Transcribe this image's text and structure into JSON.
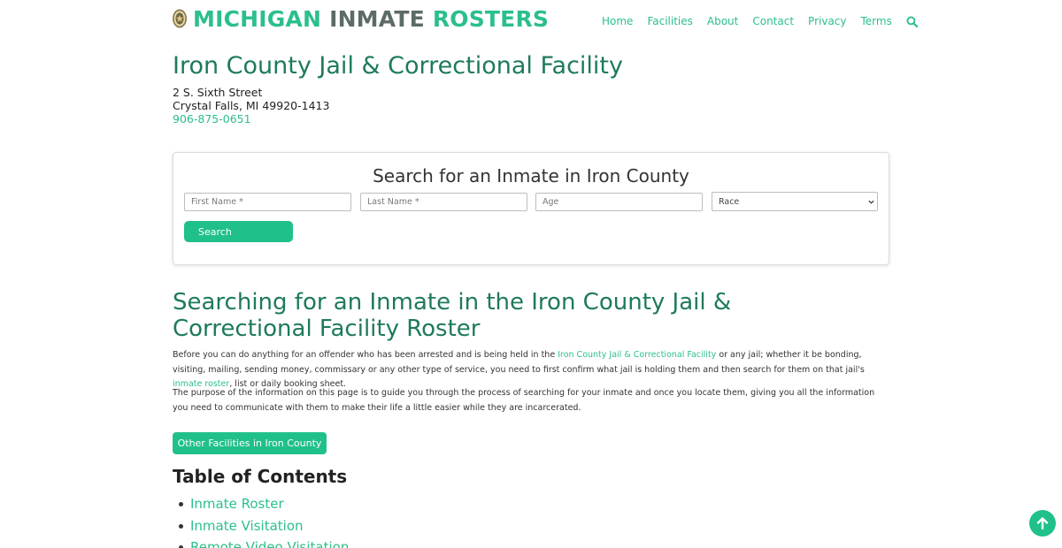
{
  "header": {
    "logo_words": [
      "MICHIGAN",
      "INMATE",
      "ROSTERS"
    ],
    "nav": [
      "Home",
      "Facilities",
      "About",
      "Contact",
      "Privacy",
      "Terms"
    ],
    "search_icon": "search-icon"
  },
  "facility": {
    "title": "Iron County Jail & Correctional Facility",
    "address_line1": "2 S. Sixth Street",
    "address_line2": "Crystal Falls, MI 49920-1413",
    "phone": "906-875-0651"
  },
  "search_form": {
    "title": "Search for an Inmate in Iron County",
    "first_name_placeholder": "First Name *",
    "last_name_placeholder": "Last Name *",
    "age_placeholder": "Age",
    "race_selected": "Race",
    "button_label": "Search"
  },
  "content": {
    "heading": "Searching for an Inmate in the Iron County Jail & Correctional Facility Roster",
    "p1_a": "Before you can do anything for an offender who has been arrested and is being held in the ",
    "p1_link1": "Iron County Jail & Correctional Facility",
    "p1_b": " or any jail; whether it be bonding, visiting, mailing, sending money, commissary or any other type of service, you need to first confirm what jail is holding them and then search for them on that jail's ",
    "p1_link2": "inmate roster",
    "p1_c": ", list or daily booking sheet.",
    "p2": "The purpose of the information on this page is to guide you through the process of searching for your inmate and once you locate them, giving you all the information you need to communicate with them to make their life a little easier while they are incarcerated.",
    "other_facilities_button": "Other Facilities in Iron County"
  },
  "toc": {
    "title": "Table of Contents",
    "items": [
      "Inmate Roster",
      "Inmate Visitation",
      "Remote Video Visitation"
    ]
  },
  "colors": {
    "accent": "#20c08a",
    "heading": "#1e7a5c",
    "logo_gray": "#5d6b66"
  },
  "icons": {
    "scroll_top": "arrow-up-icon",
    "logo": "sheriff-badge-icon"
  }
}
